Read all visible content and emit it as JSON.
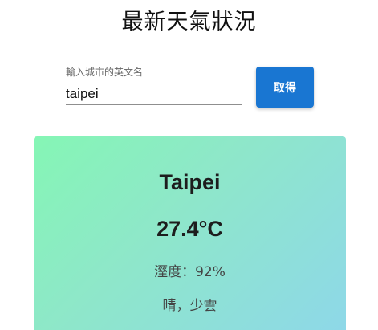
{
  "page": {
    "title": "最新天氣狀況"
  },
  "search": {
    "label": "輸入城市的英文名",
    "value": "taipei",
    "button_label": "取得"
  },
  "weather": {
    "city": "Taipei",
    "temperature": "27.4°C",
    "humidity": "溼度：92%",
    "condition": "晴，少雲"
  },
  "colors": {
    "button": "#1976d2",
    "card_gradient_start": "#85f6b5",
    "card_gradient_end": "#8ed8e8"
  }
}
